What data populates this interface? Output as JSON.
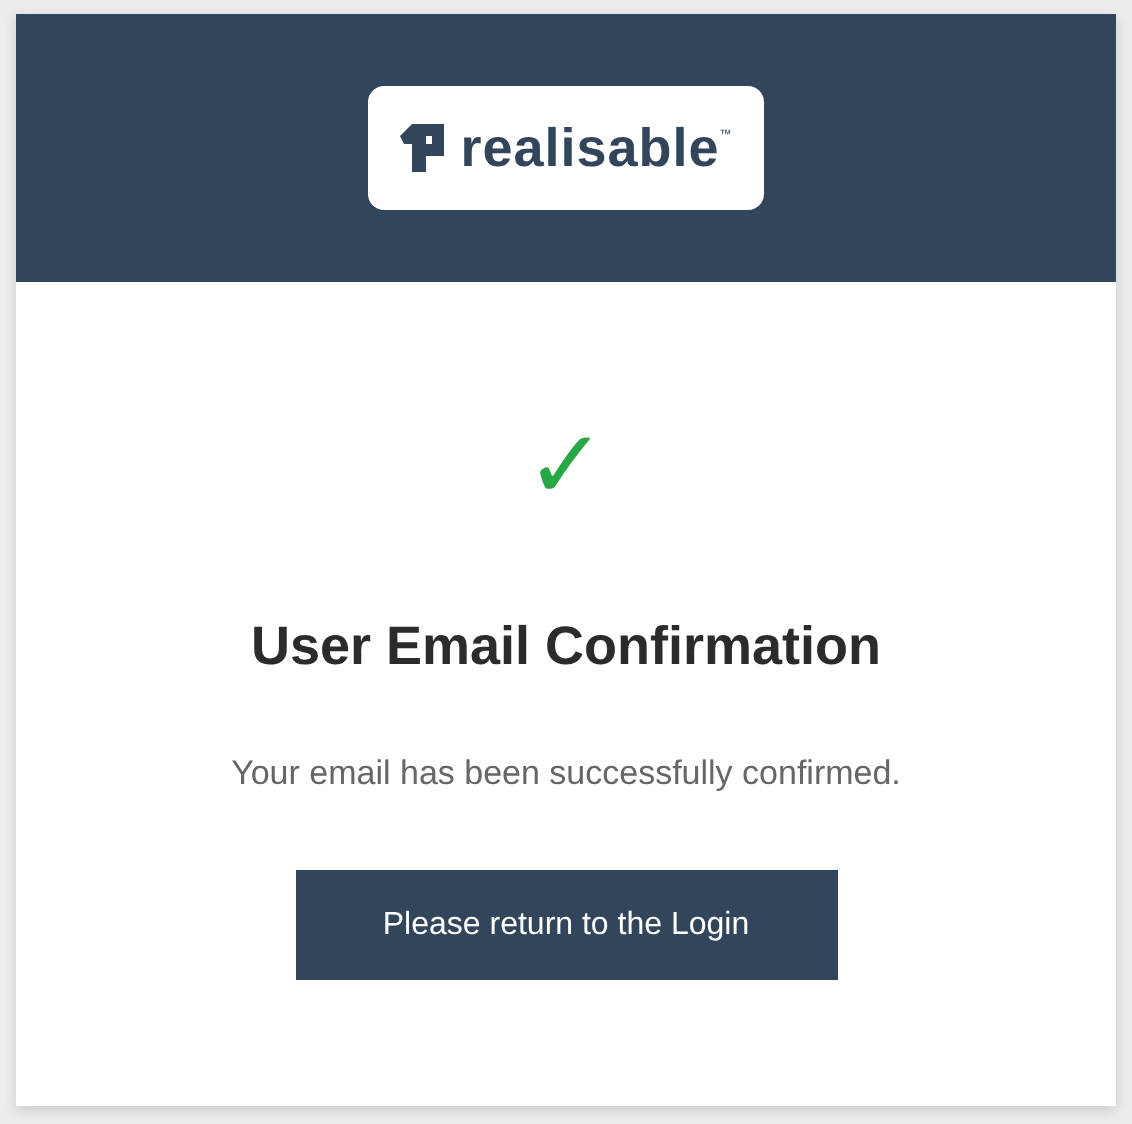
{
  "header": {
    "logo": {
      "name": "realisable",
      "trademark": "™"
    }
  },
  "status": {
    "icon": "✓"
  },
  "title": "User Email Confirmation",
  "message": "Your email has been successfully confirmed.",
  "button": {
    "label": "Please return to the Login"
  }
}
